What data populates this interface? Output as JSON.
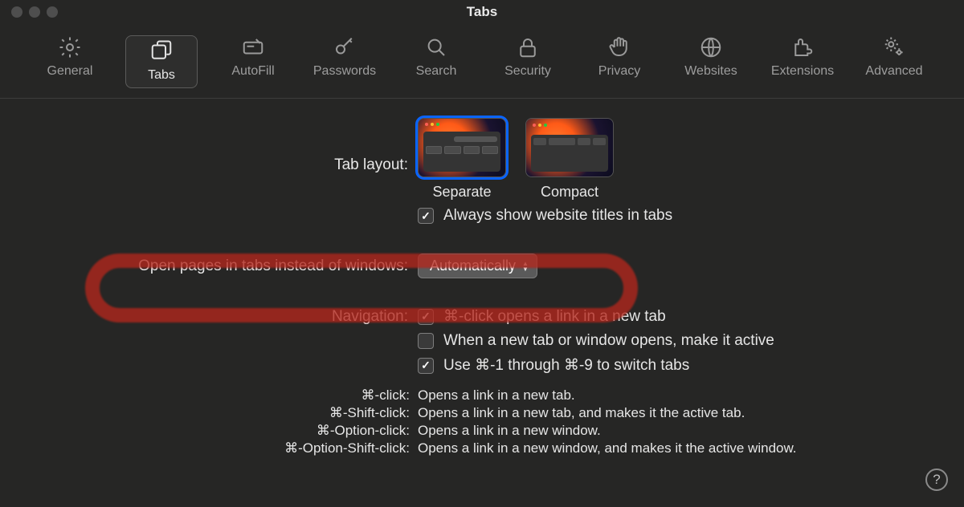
{
  "window": {
    "title": "Tabs"
  },
  "toolbar": [
    {
      "id": "general",
      "label": "General",
      "selected": false,
      "icon": "gear"
    },
    {
      "id": "tabs",
      "label": "Tabs",
      "selected": true,
      "icon": "tabs"
    },
    {
      "id": "autofill",
      "label": "AutoFill",
      "selected": false,
      "icon": "autofill"
    },
    {
      "id": "passwords",
      "label": "Passwords",
      "selected": false,
      "icon": "key"
    },
    {
      "id": "search",
      "label": "Search",
      "selected": false,
      "icon": "search"
    },
    {
      "id": "security",
      "label": "Security",
      "selected": false,
      "icon": "lock"
    },
    {
      "id": "privacy",
      "label": "Privacy",
      "selected": false,
      "icon": "hand"
    },
    {
      "id": "websites",
      "label": "Websites",
      "selected": false,
      "icon": "globe"
    },
    {
      "id": "extensions",
      "label": "Extensions",
      "selected": false,
      "icon": "puzzle"
    },
    {
      "id": "advanced",
      "label": "Advanced",
      "selected": false,
      "icon": "gears"
    }
  ],
  "tab_layout": {
    "label": "Tab layout:",
    "options": [
      {
        "id": "separate",
        "label": "Separate",
        "selected": true
      },
      {
        "id": "compact",
        "label": "Compact",
        "selected": false
      }
    ],
    "always_show_titles": {
      "label": "Always show website titles in tabs",
      "checked": true
    }
  },
  "open_pages": {
    "label": "Open pages in tabs instead of windows:",
    "value": "Automatically"
  },
  "navigation": {
    "label": "Navigation:",
    "items": [
      {
        "label": "⌘-click opens a link in a new tab",
        "checked": true
      },
      {
        "label": "When a new tab or window opens, make it active",
        "checked": false
      },
      {
        "label": "Use ⌘-1 through ⌘-9 to switch tabs",
        "checked": true
      }
    ]
  },
  "help": [
    {
      "k": "⌘-click:",
      "v": "Opens a link in a new tab."
    },
    {
      "k": "⌘-Shift-click:",
      "v": "Opens a link in a new tab, and makes it the active tab."
    },
    {
      "k": "⌘-Option-click:",
      "v": "Opens a link in a new window."
    },
    {
      "k": "⌘-Option-Shift-click:",
      "v": "Opens a link in a new window, and makes it the active window."
    }
  ]
}
